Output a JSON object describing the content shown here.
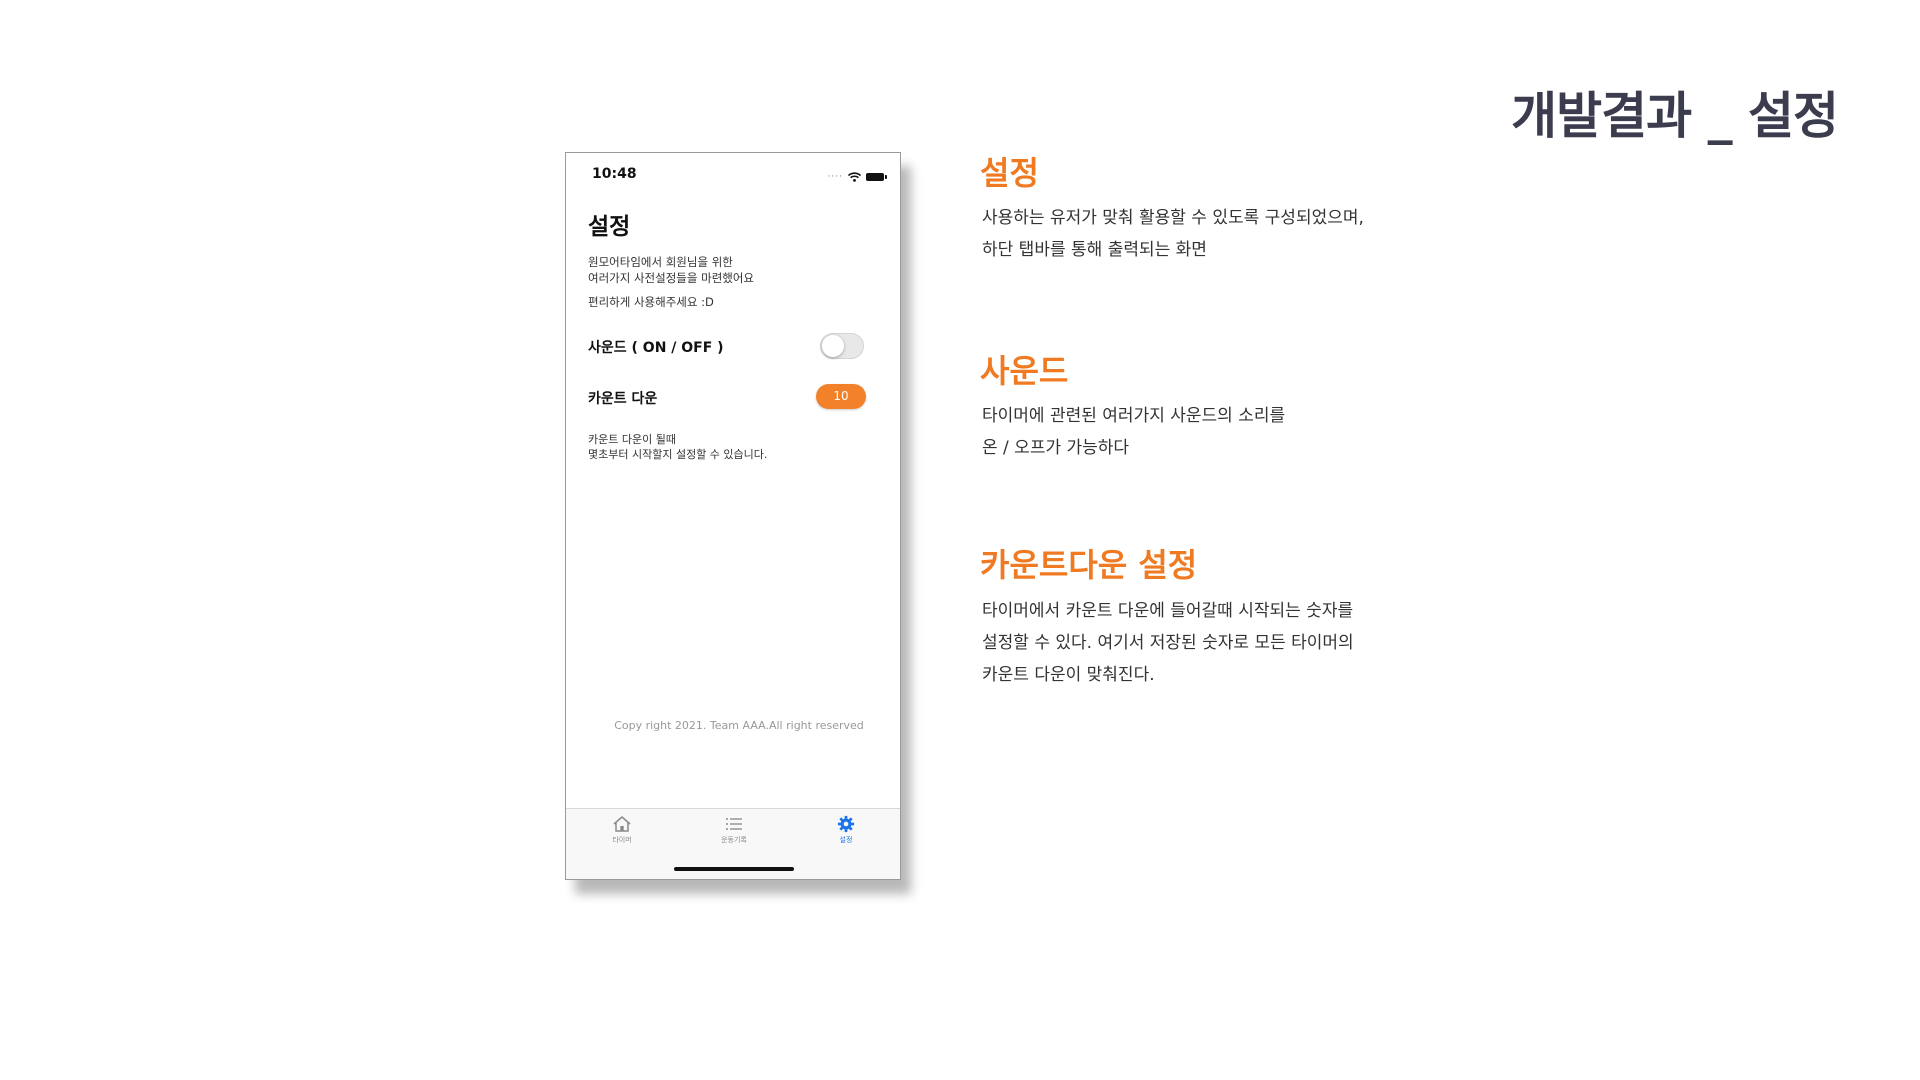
{
  "slide": {
    "title": "개발결과 _ 설정"
  },
  "phone": {
    "status_time": "10:48",
    "status_icons": [
      "signal-icon",
      "wifi-icon",
      "battery-icon"
    ],
    "screen_title": "설정",
    "intro_lines": [
      "원모어타임에서 회원님을 위한",
      "여러가지 사전설정들을 마련했어요",
      "편리하게 사용해주세요 :D"
    ],
    "sound_label": "사운드 ( ON / OFF )",
    "sound_on": false,
    "countdown_label": "카운트 다운",
    "countdown_value": "10",
    "countdown_note_lines": [
      "카운트 다운이 될때",
      "몇초부터 시작할지 설정할 수 있습니다."
    ],
    "copyright": "Copy right 2021. Team AAA.All right reserved",
    "tabs": [
      {
        "label": "타이머",
        "icon": "home-icon",
        "active": false
      },
      {
        "label": "운동기록",
        "icon": "list-icon",
        "active": false
      },
      {
        "label": "설정",
        "icon": "gear-icon",
        "active": true
      }
    ],
    "accent_color": "#f28129",
    "active_tab_color": "#1a73e8"
  },
  "sections": [
    {
      "heading": "설정",
      "lines": [
        "사용하는 유저가 맞춰 활용할 수 있도록 구성되었으며,",
        "하단 탭바를 통해 출력되는 화면"
      ]
    },
    {
      "heading": "사운드",
      "lines": [
        "타이머에 관련된 여러가지 사운드의 소리를",
        "온 / 오프가 가능하다"
      ]
    },
    {
      "heading": "카운트다운 설정",
      "lines": [
        "타이머에서 카운트 다운에 들어갈때 시작되는 숫자를",
        "설정할 수 있다. 여기서 저장된 숫자로 모든 타이머의",
        "카운트 다운이 맞춰진다."
      ]
    }
  ],
  "heading_color": "#f07a22",
  "title_color": "#3b3d4f"
}
